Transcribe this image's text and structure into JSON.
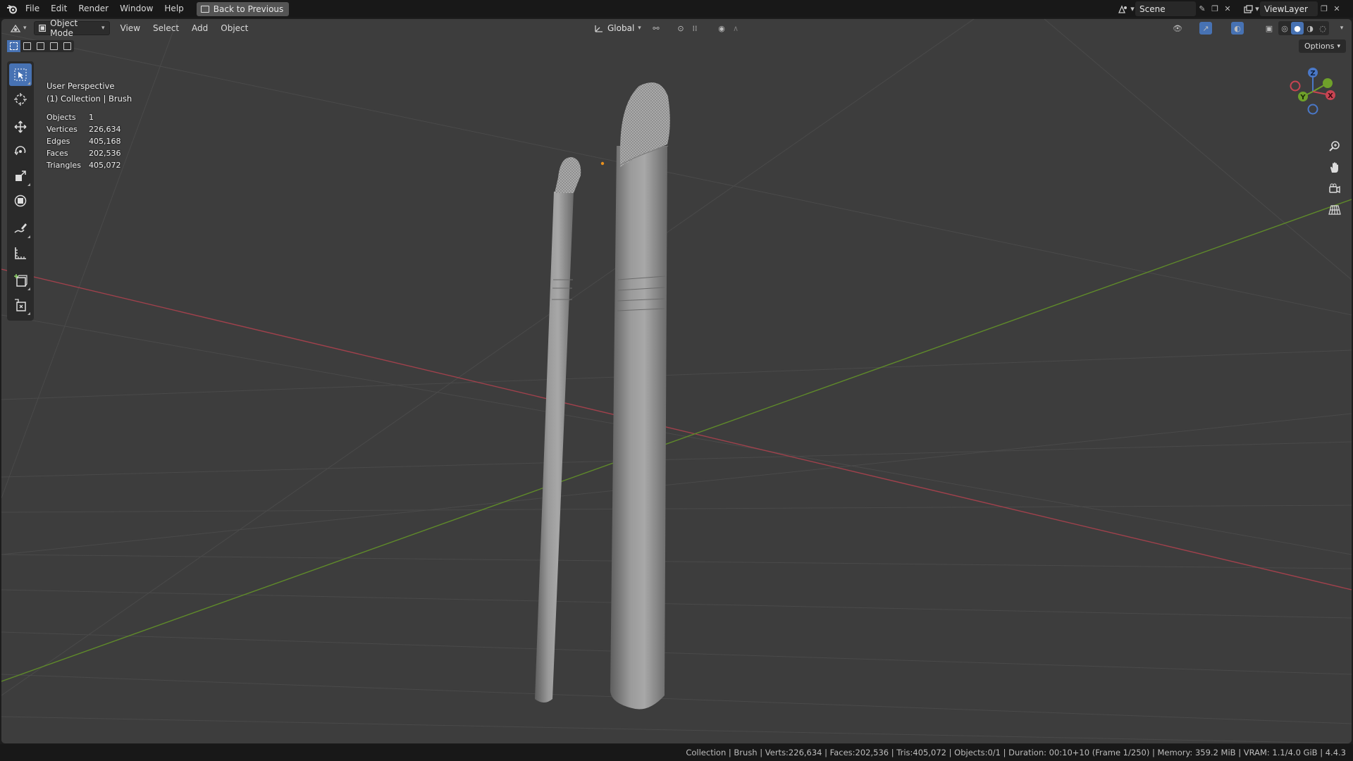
{
  "menubar": {
    "items": [
      "File",
      "Edit",
      "Render",
      "Window",
      "Help"
    ],
    "back_button": "Back to Previous",
    "scene": "Scene",
    "view_layer": "ViewLayer"
  },
  "viewport_header": {
    "mode": "Object Mode",
    "menus": [
      "View",
      "Select",
      "Add",
      "Object"
    ],
    "orientation": "Global",
    "options": "Options"
  },
  "overlay": {
    "perspective": "User Perspective",
    "collection": "(1) Collection | Brush"
  },
  "stats": [
    {
      "key": "Objects",
      "value": "1"
    },
    {
      "key": "Vertices",
      "value": "226,634"
    },
    {
      "key": "Edges",
      "value": "405,168"
    },
    {
      "key": "Faces",
      "value": "202,536"
    },
    {
      "key": "Triangles",
      "value": "405,072"
    }
  ],
  "gizmo": {
    "z": "Z",
    "y": "Y",
    "x": "X"
  },
  "statusbar": {
    "text": "Collection | Brush | Verts:226,634 | Faces:202,536 | Tris:405,072 | Objects:0/1 | Duration: 00:10+10 (Frame 1/250) | Memory: 359.2 MiB | VRAM: 1.1/4.0 GiB | 4.4.3"
  },
  "colors": {
    "viewport_bg": "#3d3d3d",
    "accent": "#4772b3",
    "x_axis": "#b8434f",
    "y_axis": "#6a8e2c"
  }
}
